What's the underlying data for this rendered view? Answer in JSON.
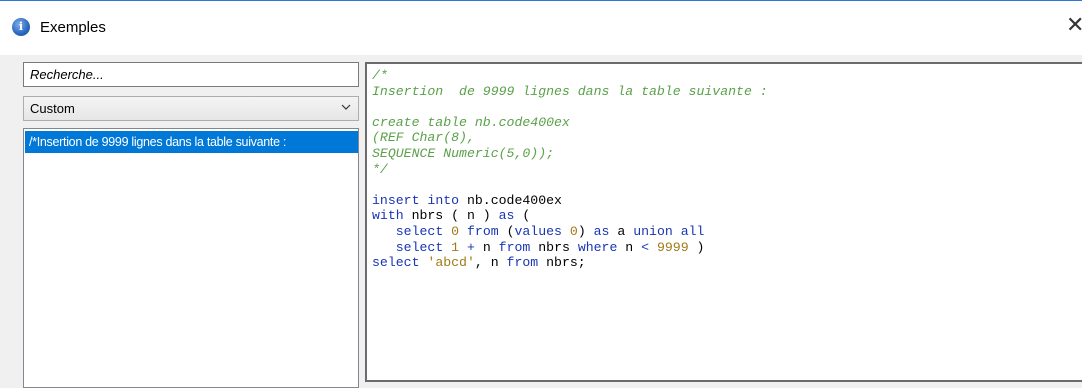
{
  "window": {
    "title": "Exemples",
    "close_glyph": "✕"
  },
  "search": {
    "placeholder": "Recherche..."
  },
  "dropdown": {
    "selected": "Custom"
  },
  "list": {
    "items": [
      "/*Insertion  de 9999 lignes dans la table suivante :"
    ]
  },
  "editor": {
    "comment_lines": [
      "/*",
      "Insertion  de 9999 lignes dans la table suivante :",
      "",
      "create table nb.code400ex",
      "(REF Char(8),",
      "SEQUENCE Numeric(5,0));",
      "*/"
    ],
    "code_lines": [
      "",
      "insert into nb.code400ex",
      "with nbrs ( n ) as (",
      "   select 0 from (values 0) as a union all",
      "   select 1 + n from nbrs where n < 9999 )",
      "select 'abcd', n from nbrs;"
    ]
  },
  "colors": {
    "selection": "#0078d7",
    "comment": "#5aa14a",
    "keyword": "#1a35b5",
    "literal": "#a07a14"
  },
  "icons": [
    "app-info-icon",
    "close-icon",
    "chevron-down-icon"
  ]
}
